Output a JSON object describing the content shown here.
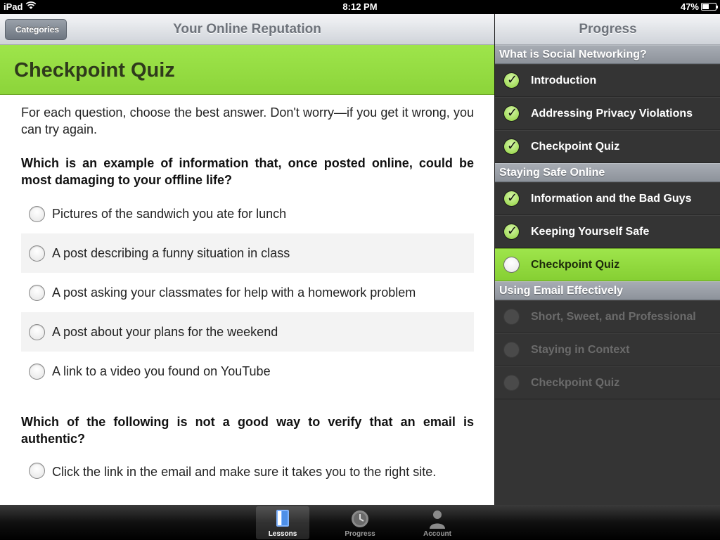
{
  "status_bar": {
    "carrier": "iPad",
    "time": "8:12 PM",
    "battery": "47%",
    "battery_fraction": 0.47
  },
  "lesson_nav": {
    "back_label": "Categories",
    "title": "Your Online Reputation"
  },
  "quiz": {
    "heading": "Checkpoint Quiz",
    "intro": "For each question, choose the best answer. Don't worry—if you get it wrong, you can try again.",
    "questions": [
      {
        "text": "Which is an example of information that, once posted online, could be most damaging to your offline life?",
        "options": [
          "Pictures of the sandwich you ate for lunch",
          "A post describing a funny situation in class",
          "A post asking your classmates for help with a homework problem",
          "A post about your plans for the weekend",
          "A link to a video you found on YouTube"
        ]
      },
      {
        "text": "Which of the following is not a good way to verify that an email is authentic?",
        "options": [
          "Click the link in the email and make sure it takes you to the right site."
        ]
      }
    ]
  },
  "progress": {
    "title": "Progress",
    "sections": [
      {
        "title": "What is Social Networking?",
        "items": [
          {
            "label": "Introduction",
            "status": "done"
          },
          {
            "label": "Addressing Privacy Violations",
            "status": "done"
          },
          {
            "label": "Checkpoint Quiz",
            "status": "done"
          }
        ]
      },
      {
        "title": "Staying Safe Online",
        "items": [
          {
            "label": "Information and the Bad Guys",
            "status": "done"
          },
          {
            "label": "Keeping Yourself Safe",
            "status": "done"
          },
          {
            "label": "Checkpoint Quiz",
            "status": "current"
          }
        ]
      },
      {
        "title": "Using Email Effectively",
        "items": [
          {
            "label": "Short, Sweet, and Professional",
            "status": "locked"
          },
          {
            "label": "Staying in Context",
            "status": "locked"
          },
          {
            "label": "Checkpoint Quiz",
            "status": "locked"
          }
        ]
      }
    ]
  },
  "tab_bar": {
    "tabs": [
      {
        "label": "Lessons",
        "icon": "lessons-icon",
        "active": true
      },
      {
        "label": "Progress",
        "icon": "clock-icon",
        "active": false
      },
      {
        "label": "Account",
        "icon": "person-icon",
        "active": false
      }
    ]
  },
  "colors": {
    "accent_green": "#9ee54b",
    "sidebar_bg": "#343434",
    "section_header": "#9aa0a8"
  }
}
